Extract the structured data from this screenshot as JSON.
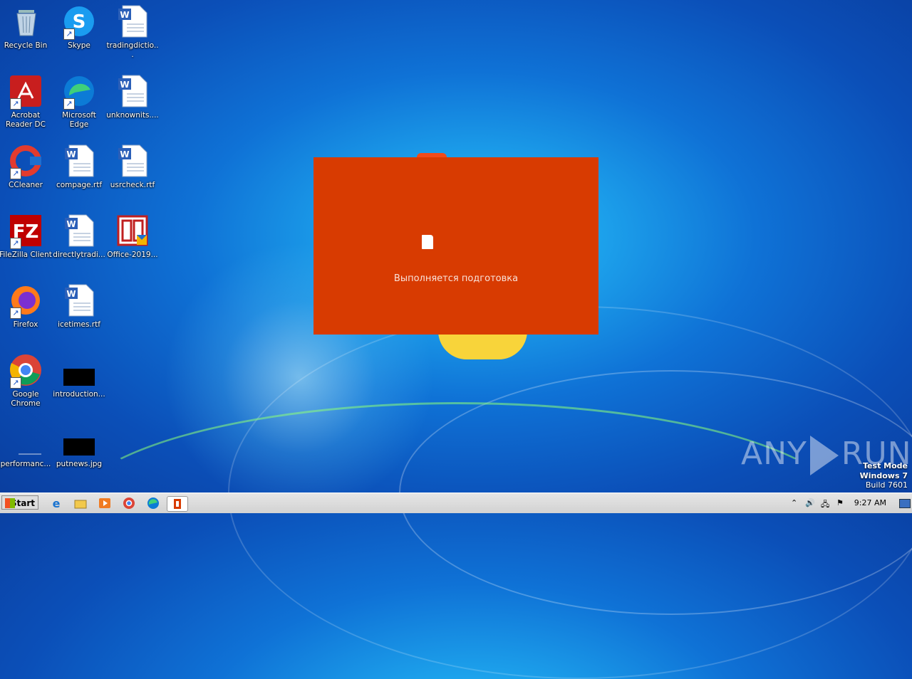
{
  "desktop": {
    "icons": [
      {
        "label": "Recycle Bin"
      },
      {
        "label": "Skype"
      },
      {
        "label": "tradingdictio..."
      },
      {
        "label": "Acrobat Reader DC"
      },
      {
        "label": "Microsoft Edge"
      },
      {
        "label": "unknownits...."
      },
      {
        "label": "CCleaner"
      },
      {
        "label": "compage.rtf"
      },
      {
        "label": "usrcheck.rtf"
      },
      {
        "label": "FileZilla Client"
      },
      {
        "label": "directlytradi..."
      },
      {
        "label": "Office-2019..."
      },
      {
        "label": "Firefox"
      },
      {
        "label": "icetimes.rtf"
      },
      {
        "label": "Google Chrome"
      },
      {
        "label": "introduction..."
      },
      {
        "label": "performanc..."
      },
      {
        "label": "putnews.jpg"
      }
    ]
  },
  "splash": {
    "status_text": "Выполняется подготовка",
    "background_color": "#d83b01"
  },
  "watermark": {
    "text_left": "ANY",
    "text_right": "RUN"
  },
  "system_info": {
    "line1": "Test Mode",
    "line2": "Windows 7",
    "line3": "Build 7601"
  },
  "taskbar": {
    "start_label": "Start",
    "pinned": [
      "internet-explorer-icon",
      "explorer-icon",
      "media-player-icon",
      "chrome-icon",
      "edge-icon",
      "office-icon"
    ],
    "clock": "9:27 AM"
  }
}
